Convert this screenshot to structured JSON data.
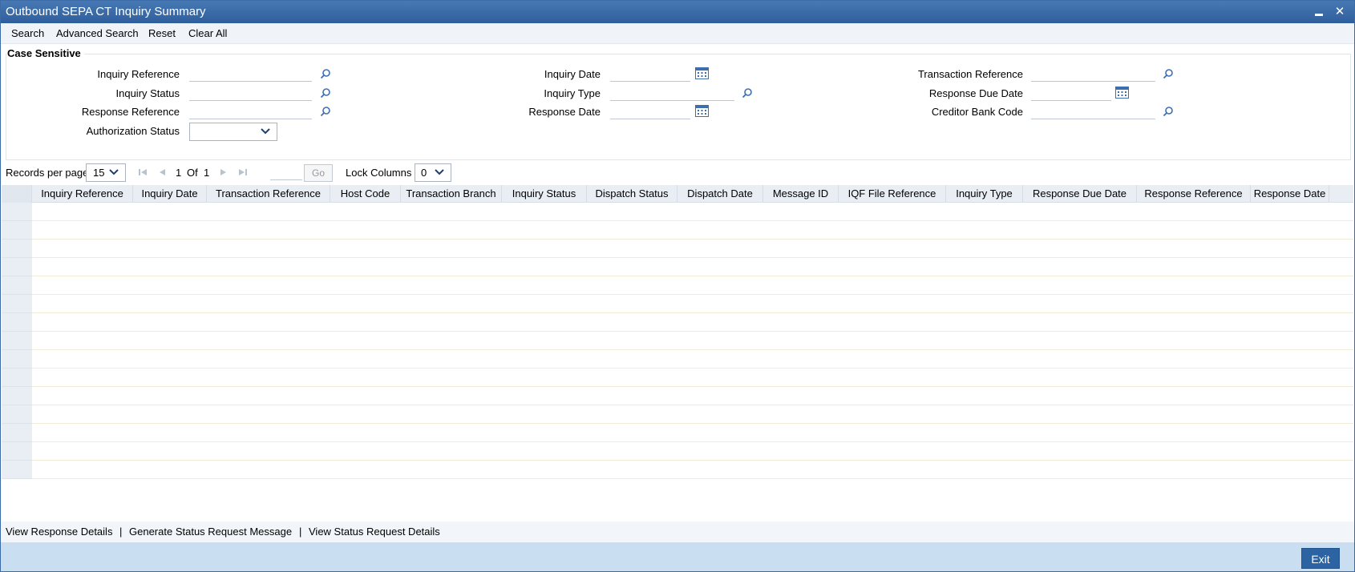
{
  "window": {
    "title": "Outbound SEPA CT Inquiry Summary",
    "minimize_label": "",
    "close_label": "✕"
  },
  "toolbar": {
    "search": "Search",
    "advanced_search": "Advanced Search",
    "reset": "Reset",
    "clear_all": "Clear All"
  },
  "criteria": {
    "legend": "Case Sensitive",
    "inquiry_reference": {
      "label": "Inquiry Reference",
      "value": ""
    },
    "inquiry_status": {
      "label": "Inquiry Status",
      "value": ""
    },
    "response_reference": {
      "label": "Response Reference",
      "value": ""
    },
    "authorization_status": {
      "label": "Authorization Status",
      "value": ""
    },
    "inquiry_date": {
      "label": "Inquiry Date",
      "value": ""
    },
    "inquiry_type": {
      "label": "Inquiry Type",
      "value": ""
    },
    "response_date": {
      "label": "Response Date",
      "value": ""
    },
    "transaction_reference": {
      "label": "Transaction Reference",
      "value": ""
    },
    "response_due_date": {
      "label": "Response Due Date",
      "value": ""
    },
    "creditor_bank_code": {
      "label": "Creditor Bank Code",
      "value": ""
    }
  },
  "pager": {
    "records_per_page_label": "Records per page",
    "records_per_page": "15",
    "current_page": "1",
    "of_label": "Of",
    "total_pages": "1",
    "go_label": "Go",
    "lock_columns_label": "Lock Columns",
    "lock_columns": "0"
  },
  "grid": {
    "columns": [
      "Inquiry Reference",
      "Inquiry Date",
      "Transaction Reference",
      "Host Code",
      "Transaction Branch",
      "Inquiry Status",
      "Dispatch Status",
      "Dispatch Date",
      "Message ID",
      "IQF File Reference",
      "Inquiry Type",
      "Response Due Date",
      "Response Reference",
      "Response Date"
    ],
    "row_count": 15
  },
  "bottom_links": {
    "view_response_details": "View Response Details",
    "generate_status_request": "Generate Status Request Message",
    "view_status_request": "View Status Request Details",
    "separator": "|"
  },
  "footer": {
    "exit": "Exit"
  },
  "colors": {
    "title_bar": "#2f5e9c",
    "footer": "#c9def1",
    "exit_button": "#2b63a3",
    "link_icon": "#3d6fb0"
  }
}
